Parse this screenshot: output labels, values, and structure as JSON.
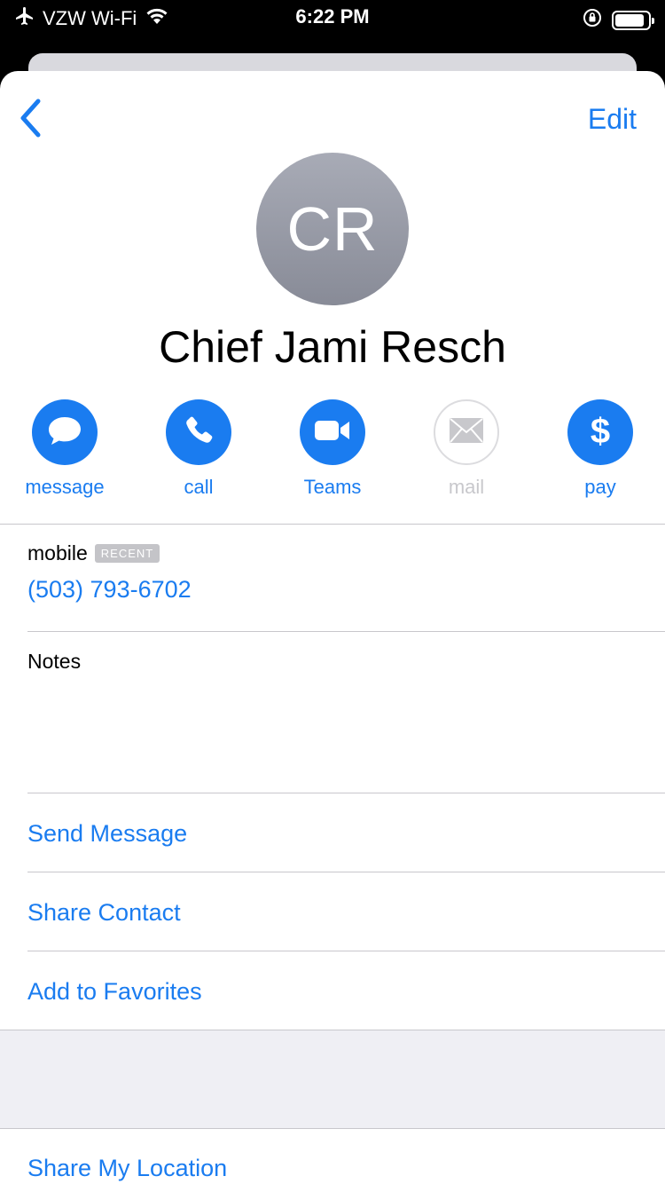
{
  "status_bar": {
    "carrier": "VZW Wi-Fi",
    "time": "6:22 PM"
  },
  "nav": {
    "edit_label": "Edit"
  },
  "contact": {
    "initials": "CR",
    "name": "Chief Jami Resch"
  },
  "actions": [
    {
      "label": "message",
      "icon": "message-bubble-icon",
      "enabled": true
    },
    {
      "label": "call",
      "icon": "phone-icon",
      "enabled": true
    },
    {
      "label": "Teams",
      "icon": "video-camera-icon",
      "enabled": true
    },
    {
      "label": "mail",
      "icon": "envelope-icon",
      "enabled": false
    },
    {
      "label": "pay",
      "icon": "dollar-icon",
      "enabled": true
    }
  ],
  "phone": {
    "label": "mobile",
    "badge": "RECENT",
    "number": "(503) 793-6702"
  },
  "notes": {
    "label": "Notes"
  },
  "links": {
    "send_message": "Send Message",
    "share_contact": "Share Contact",
    "add_to_favorites": "Add to Favorites",
    "share_my_location": "Share My Location"
  },
  "colors": {
    "accent": "#1a7cf0",
    "disabled": "#c8c8cc",
    "separator": "#c8c7cc",
    "group_background": "#efeff4"
  }
}
